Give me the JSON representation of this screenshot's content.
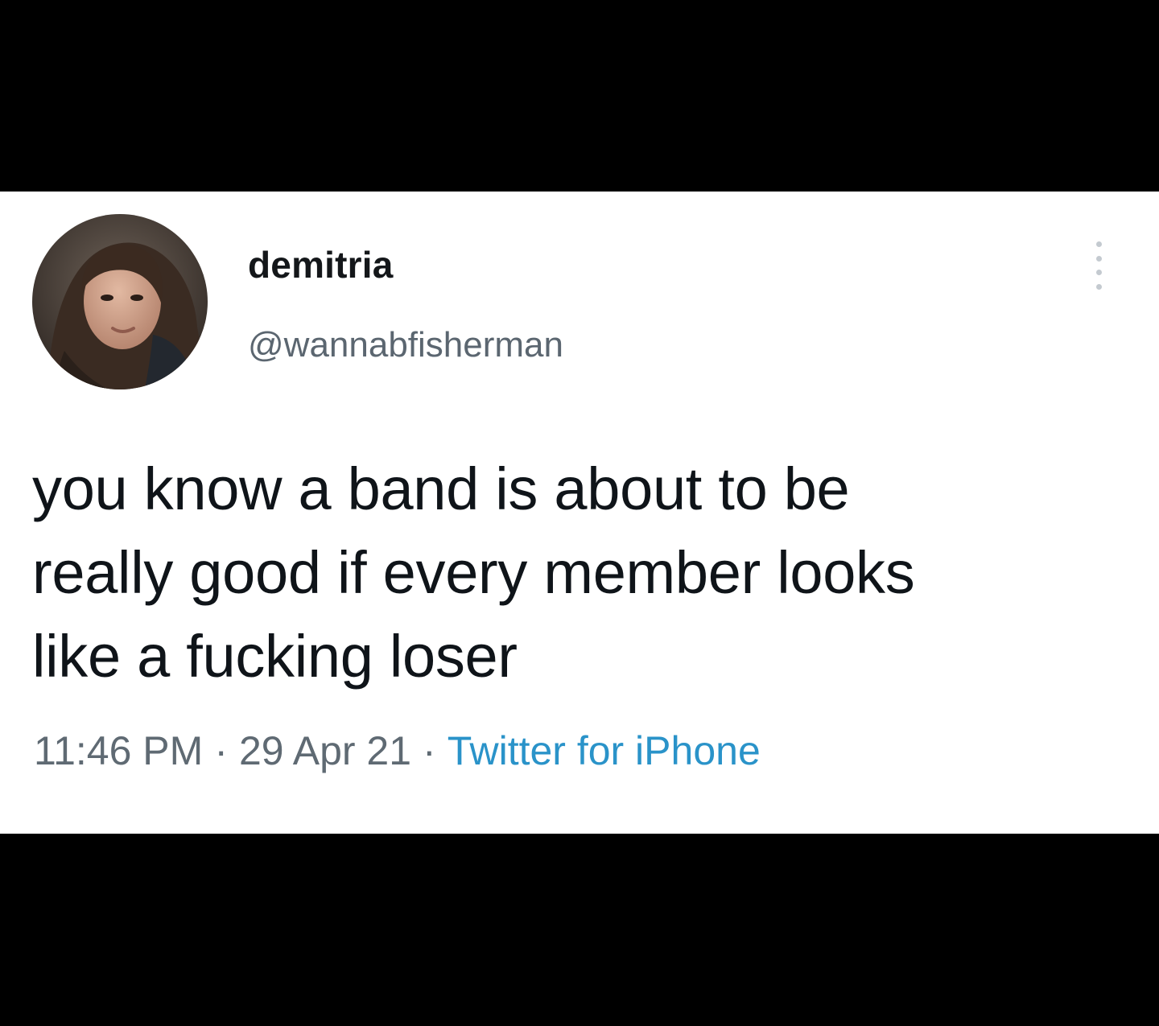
{
  "tweet": {
    "display_name": "demitria",
    "handle": "@wannabfisherman",
    "avatar_icon": "profile-photo",
    "more_icon": "vertical-ellipsis-icon",
    "text_lines": [
      "you know a band is about to be",
      "really good if every member looks",
      "like a fucking loser"
    ],
    "time": "11:46 PM",
    "date": "29 Apr 21",
    "separator": "·",
    "source": "Twitter for iPhone"
  },
  "colors": {
    "background": "#000000",
    "card": "#ffffff",
    "text": "#0f1419",
    "secondary_text": "#5f6a73",
    "link": "#2a93c9"
  }
}
